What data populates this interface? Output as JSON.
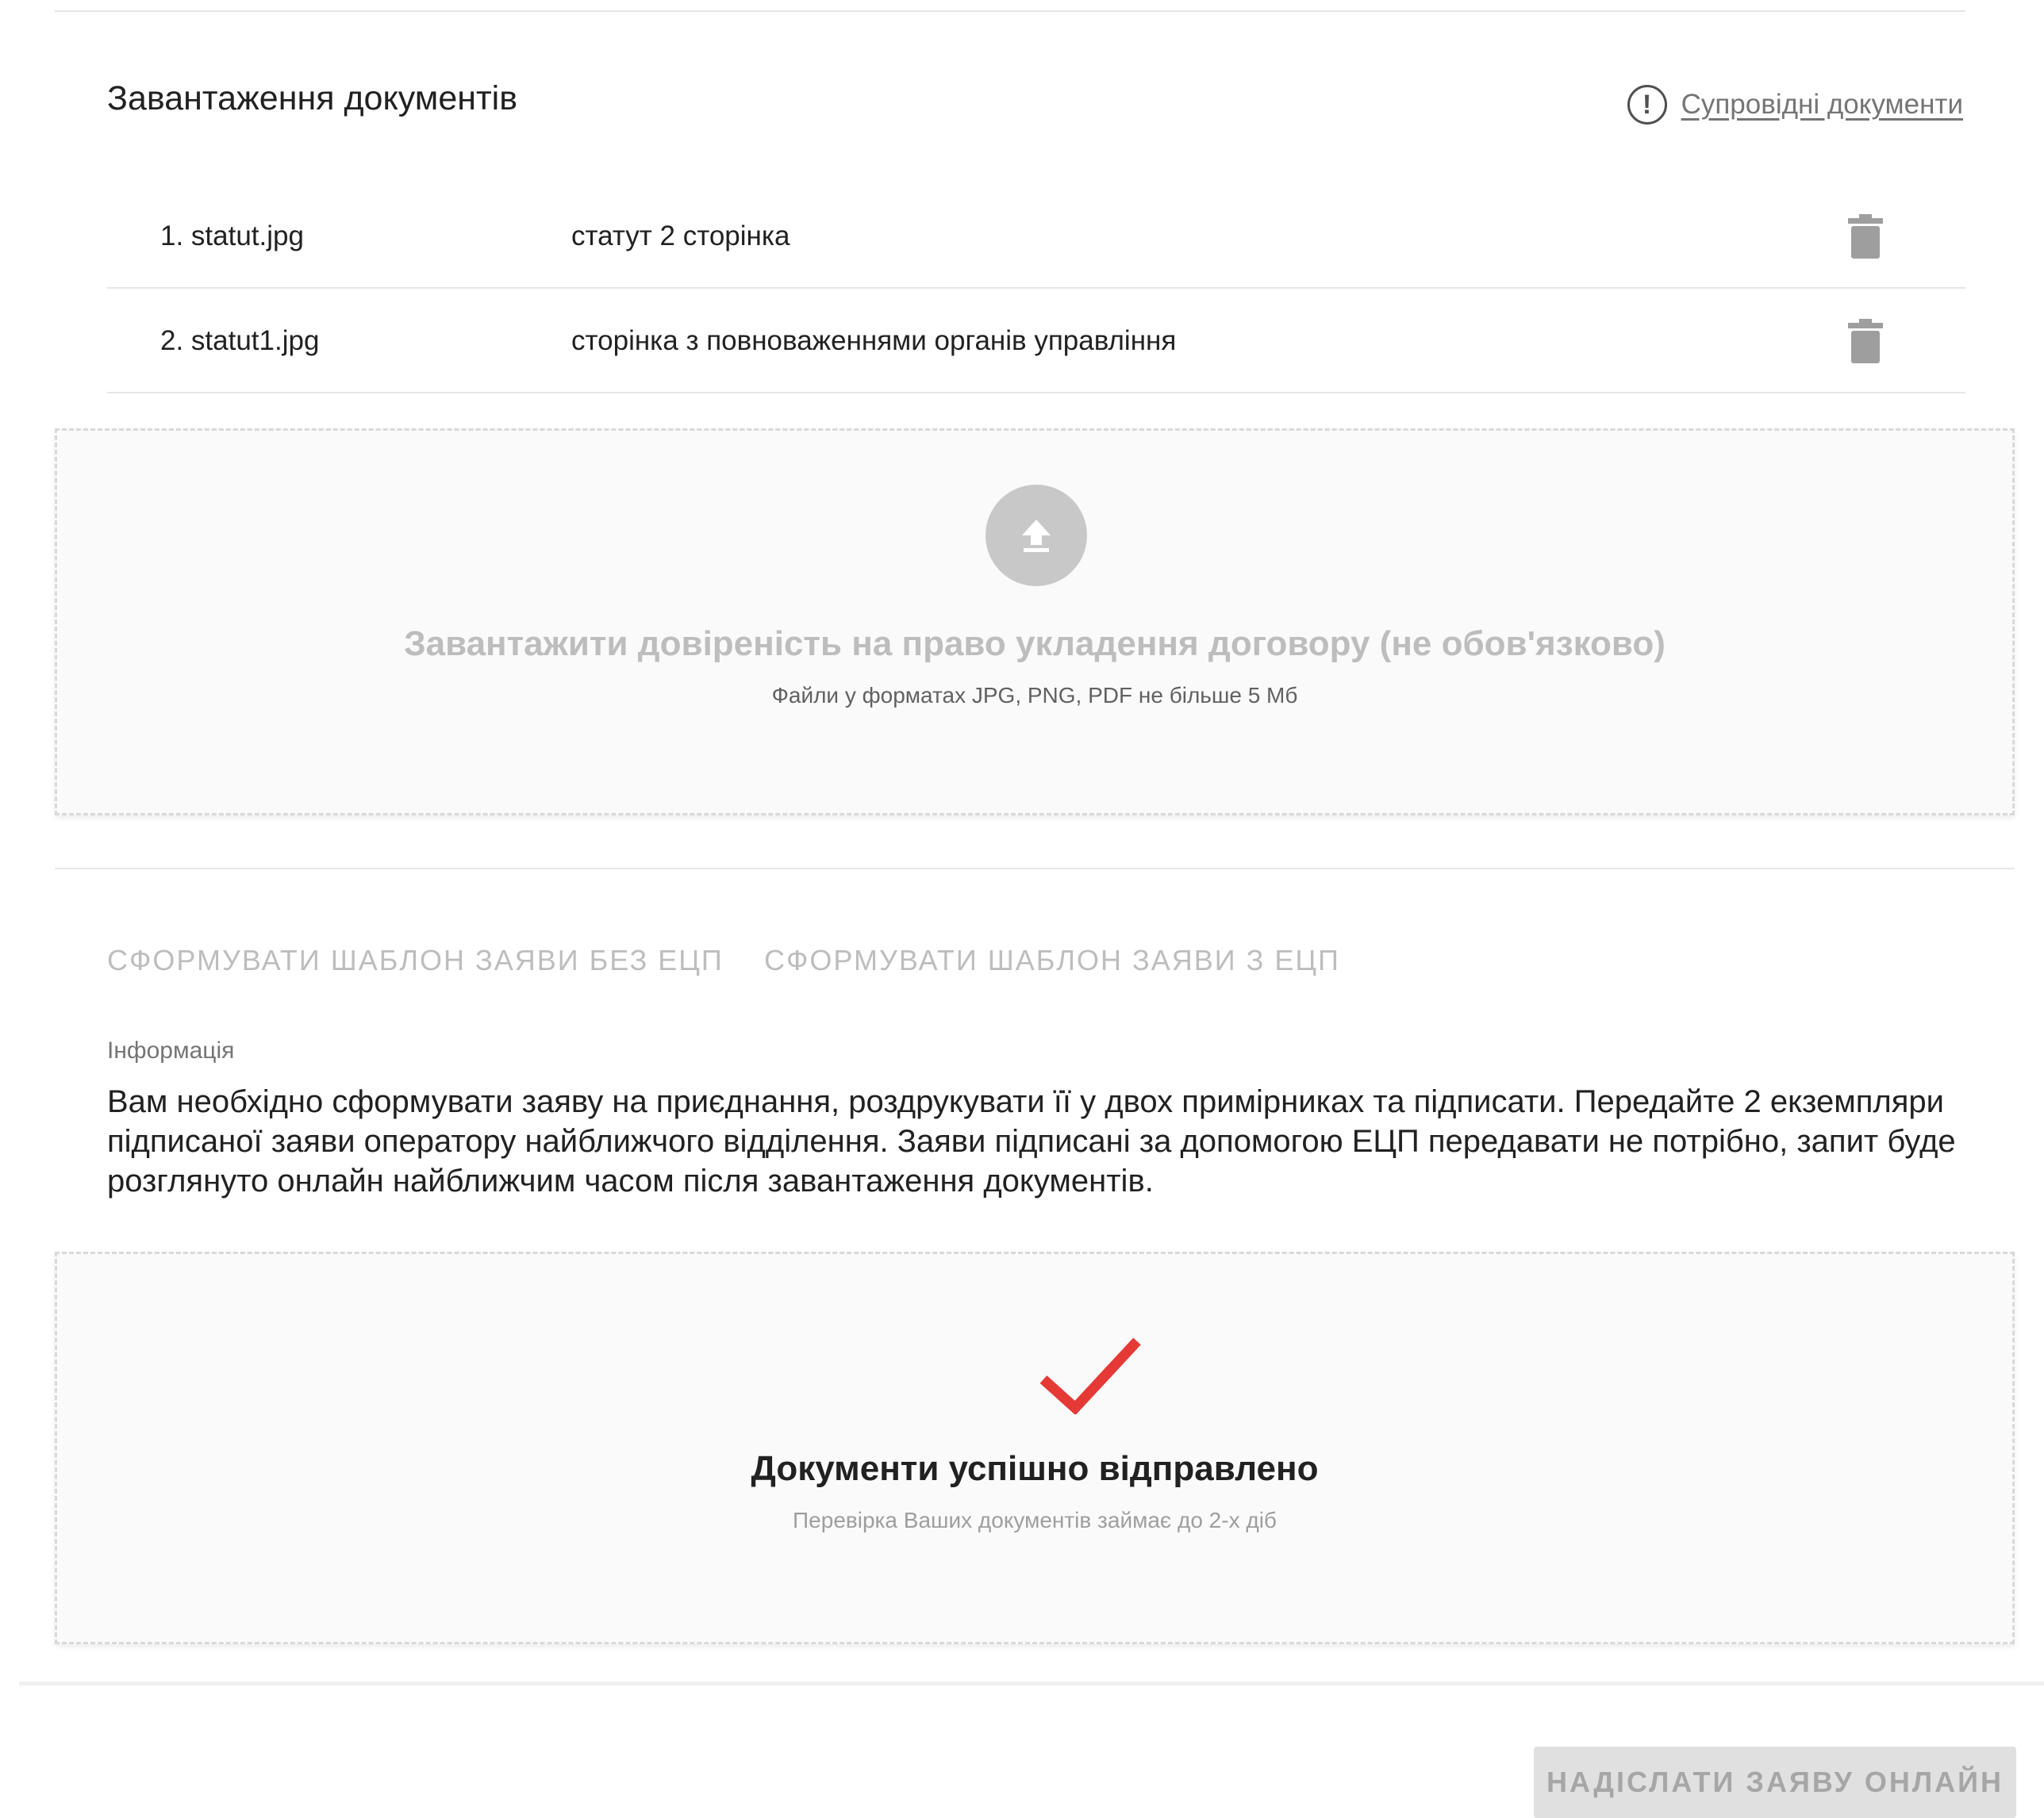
{
  "section": {
    "title": "Завантаження документів",
    "docs_link": "Супровідні документи"
  },
  "files": [
    {
      "name": "1. statut.jpg",
      "description": "статут 2 сторінка"
    },
    {
      "name": "2. statut1.jpg",
      "description": "сторінка з повноваженнями органів управління"
    }
  ],
  "upload": {
    "title": "Завантажити довіреність на право укладення договору (не обов'язково)",
    "subtitle": "Файли у форматах JPG, PNG, PDF не більше 5 Мб",
    "icon": "upload-arrow-icon"
  },
  "templates": {
    "without_signature": "СФОРМУВАТИ ШАБЛОН ЗАЯВИ БЕЗ ЕЦП",
    "with_signature": "СФОРМУВАТИ ШАБЛОН ЗАЯВИ З ЕЦП"
  },
  "info": {
    "label": "Інформація",
    "text": "Вам необхідно сформувати заяву на приєднання, роздрукувати її у двох примірниках та підписати. Передайте 2 екземпляри підписаної заяви оператору найближчого відділення. Заяви підписані за допомогою ЕЦП передавати не потрібно, запит буде розглянуто онлайн найближчим часом після завантаження документів."
  },
  "success": {
    "title": "Документи успішно відправлено",
    "subtitle": "Перевірка Ваших документів займає до 2-х діб",
    "icon": "checkmark-icon"
  },
  "footer": {
    "submit_label": "НАДІСЛАТИ ЗАЯВУ ОНЛАЙН"
  },
  "colors": {
    "check": "#e53935",
    "muted": "#bdbdbd",
    "text": "#212121"
  }
}
